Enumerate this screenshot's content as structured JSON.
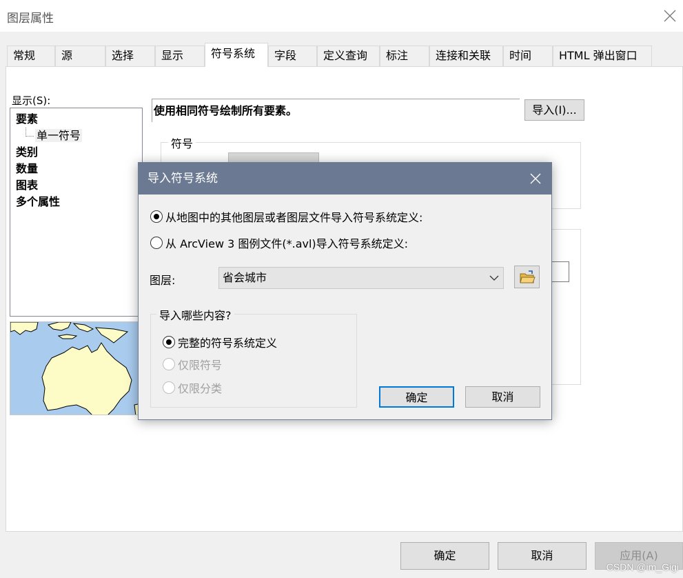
{
  "window": {
    "title": "图层属性"
  },
  "tabs": [
    {
      "label": "常规",
      "active": false
    },
    {
      "label": "源",
      "active": false
    },
    {
      "label": "选择",
      "active": false
    },
    {
      "label": "显示",
      "active": false
    },
    {
      "label": "符号系统",
      "active": true
    },
    {
      "label": "字段",
      "active": false
    },
    {
      "label": "定义查询",
      "active": false
    },
    {
      "label": "标注",
      "active": false
    },
    {
      "label": "连接和关联",
      "active": false
    },
    {
      "label": "时间",
      "active": false
    },
    {
      "label": "HTML 弹出窗口",
      "active": false
    }
  ],
  "show_panel": {
    "label": "显示(S):",
    "tree": {
      "features": "要素",
      "single_symbol": "单一符号",
      "categories": "类别",
      "quantities": "数量",
      "charts": "图表",
      "multiple_attributes": "多个属性"
    }
  },
  "description": "使用相同符号绘制所有要素。",
  "import_button": "导入(I)...",
  "symbol_group_label": "符号",
  "dialog": {
    "title": "导入符号系统",
    "option_layer": "从地图中的其他图层或者图层文件导入符号系统定义:",
    "option_avl": "从 ArcView 3 图例文件(*.avl)导入符号系统定义:",
    "layer_label": "图层:",
    "layer_value": "省会城市",
    "group_label": "导入哪些内容?",
    "content_full": "完整的符号系统定义",
    "content_symbols": "仅限符号",
    "content_classes": "仅限分类",
    "ok": "确定",
    "cancel": "取消"
  },
  "footer": {
    "ok": "确定",
    "cancel": "取消",
    "apply": "应用(A)"
  },
  "watermark": "CSDN @im_Gigi",
  "colors": {
    "dialog_title_bar": "#6b7a92",
    "map_sea": "#a9cbed",
    "map_land": "#fdfbc6"
  }
}
